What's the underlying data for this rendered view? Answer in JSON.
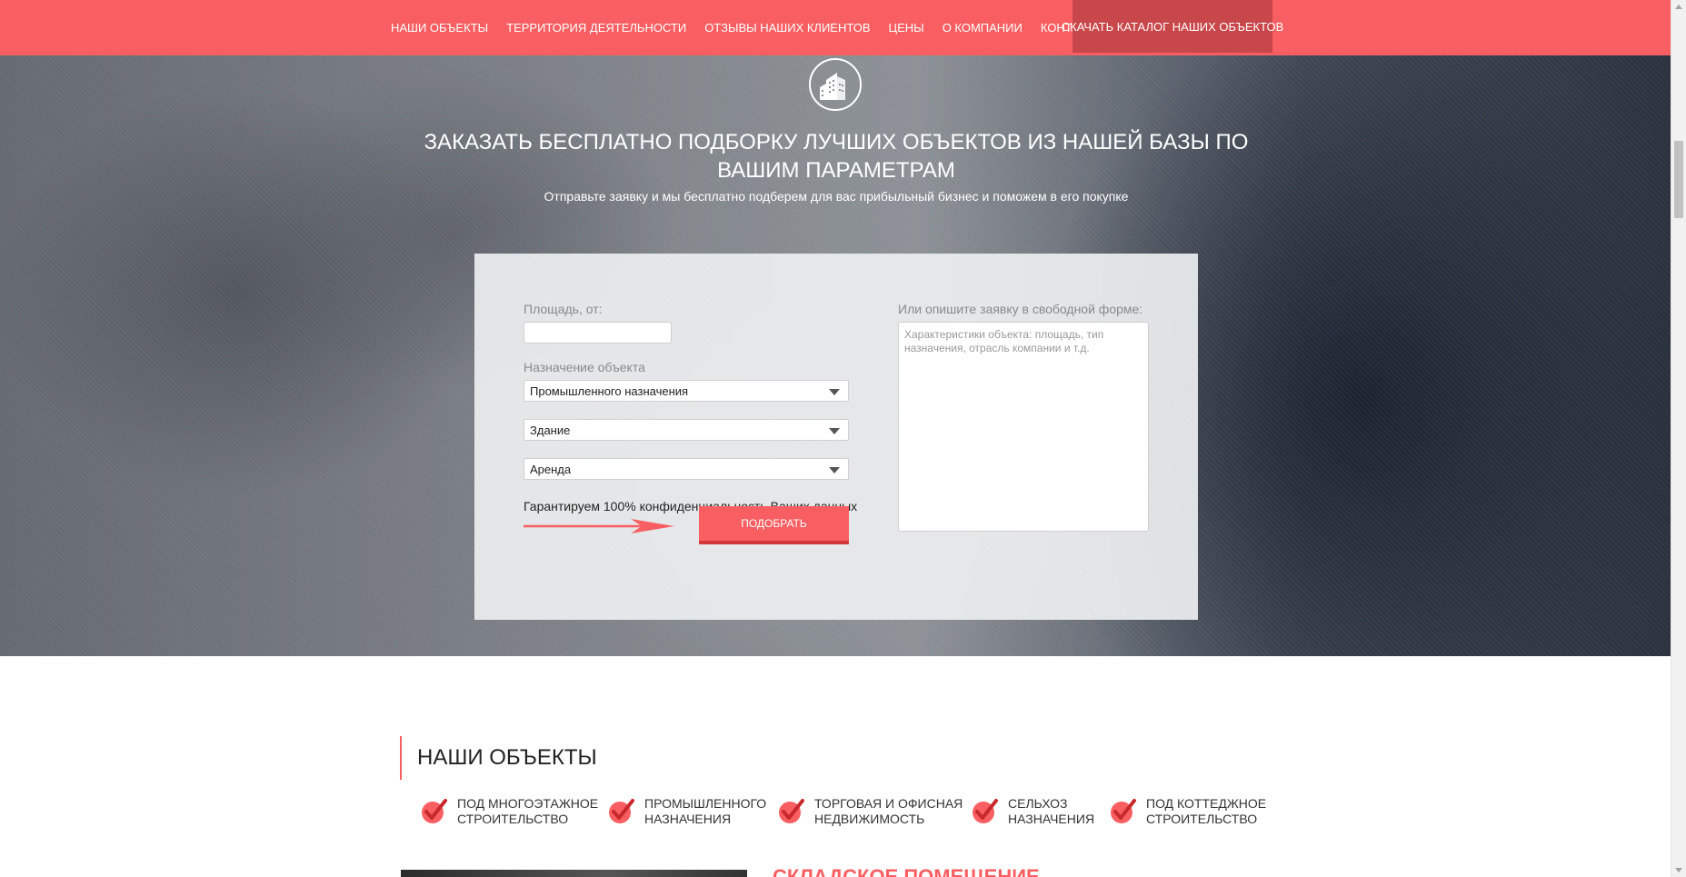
{
  "nav": {
    "items": [
      "НАШИ ОБЪЕКТЫ",
      "ТЕРРИТОРИЯ ДЕЯТЕЛЬНОСТИ",
      "ОТЗЫВЫ НАШИХ КЛИЕНТОВ",
      "ЦЕНЫ",
      "О КОМПАНИИ",
      "КОНТАКТЫ"
    ],
    "cta": "СКАЧАТЬ КАТАЛОГ НАШИХ ОБЪЕКТОВ"
  },
  "hero": {
    "logo_icon": "buildings-icon",
    "title": "ЗАКАЗАТЬ БЕСПЛАТНО ПОДБОРКУ ЛУЧШИХ ОБЪЕКТОВ ИЗ НАШЕЙ БАЗЫ ПО ВАШИМ ПАРАМЕТРАМ",
    "subtitle": "Отправьте заявку и мы бесплатно подберем для вас прибыльный бизнес и поможем в его покупке"
  },
  "form": {
    "area_label": "Площадь, от:",
    "area_value": "",
    "purpose_label": "Назначение объекта",
    "purpose_value": "Промышленного назначения",
    "type_value": "Здание",
    "deal_value": "Аренда",
    "privacy_note": "Гарантируем 100% конфиденциальность Ваших данных",
    "submit_label": "ПОДОБРАТЬ",
    "free_form_label": "Или опишите заявку в свободной форме:",
    "free_form_placeholder": "Характеристики объекта: площадь, тип назначения, отрасль компании и т.д.",
    "arrow_icon": "arrow-right-icon"
  },
  "objects": {
    "title": "НАШИ ОБЪЕКТЫ",
    "categories": [
      {
        "line1": "ПОД МНОГОЭТАЖНОЕ",
        "line2": "СТРОИТЕЛЬСТВО"
      },
      {
        "line1": "ПРОМЫШЛЕННОГО",
        "line2": "НАЗНАЧЕНИЯ"
      },
      {
        "line1": "ТОРГОВАЯ И ОФИСНАЯ",
        "line2": "НЕДВИЖИМОСТЬ"
      },
      {
        "line1": "СЕЛЬХОЗ",
        "line2": "НАЗНАЧЕНИЯ"
      },
      {
        "line1": "ПОД КОТТЕДЖНОЕ",
        "line2": "СТРОИТЕЛЬСТВО"
      }
    ],
    "category_icon": "checkmark-badge-icon",
    "next_heading": "СКЛАДСКОЕ ПОМЕЩЕНИЕ"
  },
  "colors": {
    "accent": "#f95f62",
    "accent_dark": "#c8474a",
    "panel": "#eceef0"
  }
}
